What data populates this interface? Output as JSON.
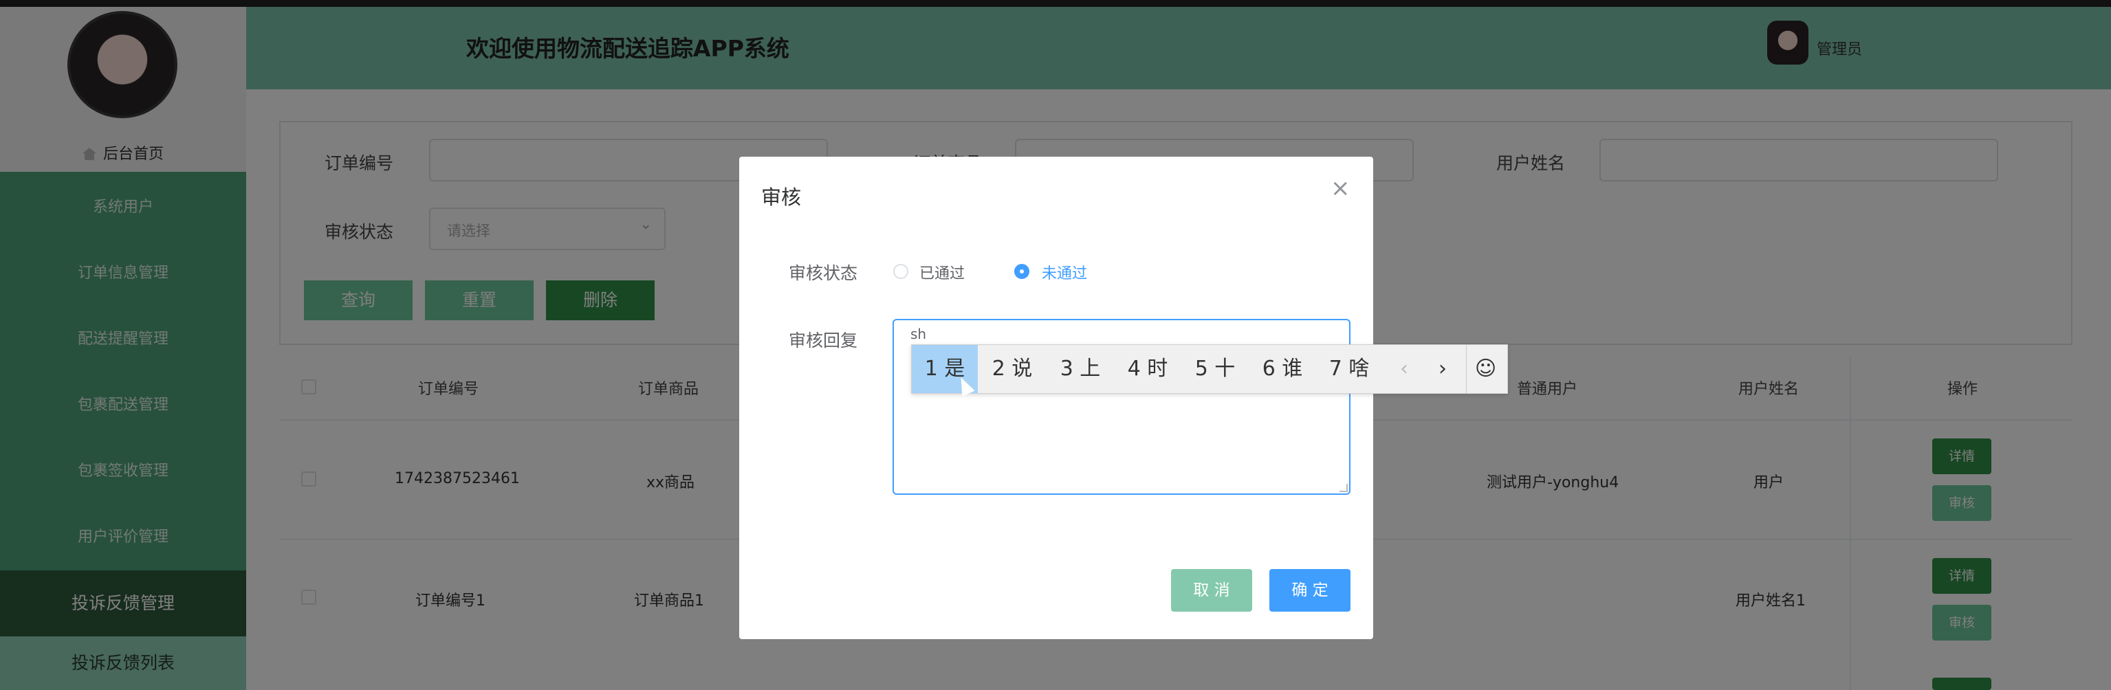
{
  "header": {
    "title": "欢迎使用物流配送追踪APP系统",
    "user": "管理员"
  },
  "sidebar": {
    "home": "后台首页",
    "items": [
      {
        "label": "系统用户"
      },
      {
        "label": "订单信息管理"
      },
      {
        "label": "配送提醒管理"
      },
      {
        "label": "包裹配送管理"
      },
      {
        "label": "包裹签收管理"
      },
      {
        "label": "用户评价管理"
      },
      {
        "label": "投诉反馈管理"
      },
      {
        "label": "投诉反馈列表"
      }
    ]
  },
  "search": {
    "order_no_label": "订单编号",
    "product_label": "订单商品",
    "username_label": "用户姓名",
    "status_label": "审核状态",
    "status_placeholder": "请选择",
    "query_btn": "查询",
    "reset_btn": "重置",
    "delete_btn": "删除"
  },
  "table": {
    "headers": [
      "订单编号",
      "订单商品",
      "普通用户",
      "用户姓名",
      "操作"
    ],
    "rows": [
      {
        "order_no": "1742387523461",
        "product": "xx商品",
        "user": "测试用户-yonghu4",
        "name": "用户"
      },
      {
        "order_no": "订单编号1",
        "product": "订单商品1",
        "user": "",
        "name": "用户姓名1"
      }
    ],
    "detail_btn": "详情",
    "audit_btn": "审核"
  },
  "dialog": {
    "title": "审核",
    "close": "×",
    "status_label": "审核状态",
    "options": [
      "已通过",
      "未通过"
    ],
    "selected": "未通过",
    "reply_label": "审核回复",
    "reply_value": "sh",
    "cancel": "取 消",
    "confirm": "确 定"
  },
  "ime": {
    "candidates": [
      "1 是",
      "2 说",
      "3 上",
      "4 时",
      "5 十",
      "6 谁",
      "7 啥"
    ],
    "prev": "‹",
    "next": "›",
    "emoji": "☺"
  }
}
